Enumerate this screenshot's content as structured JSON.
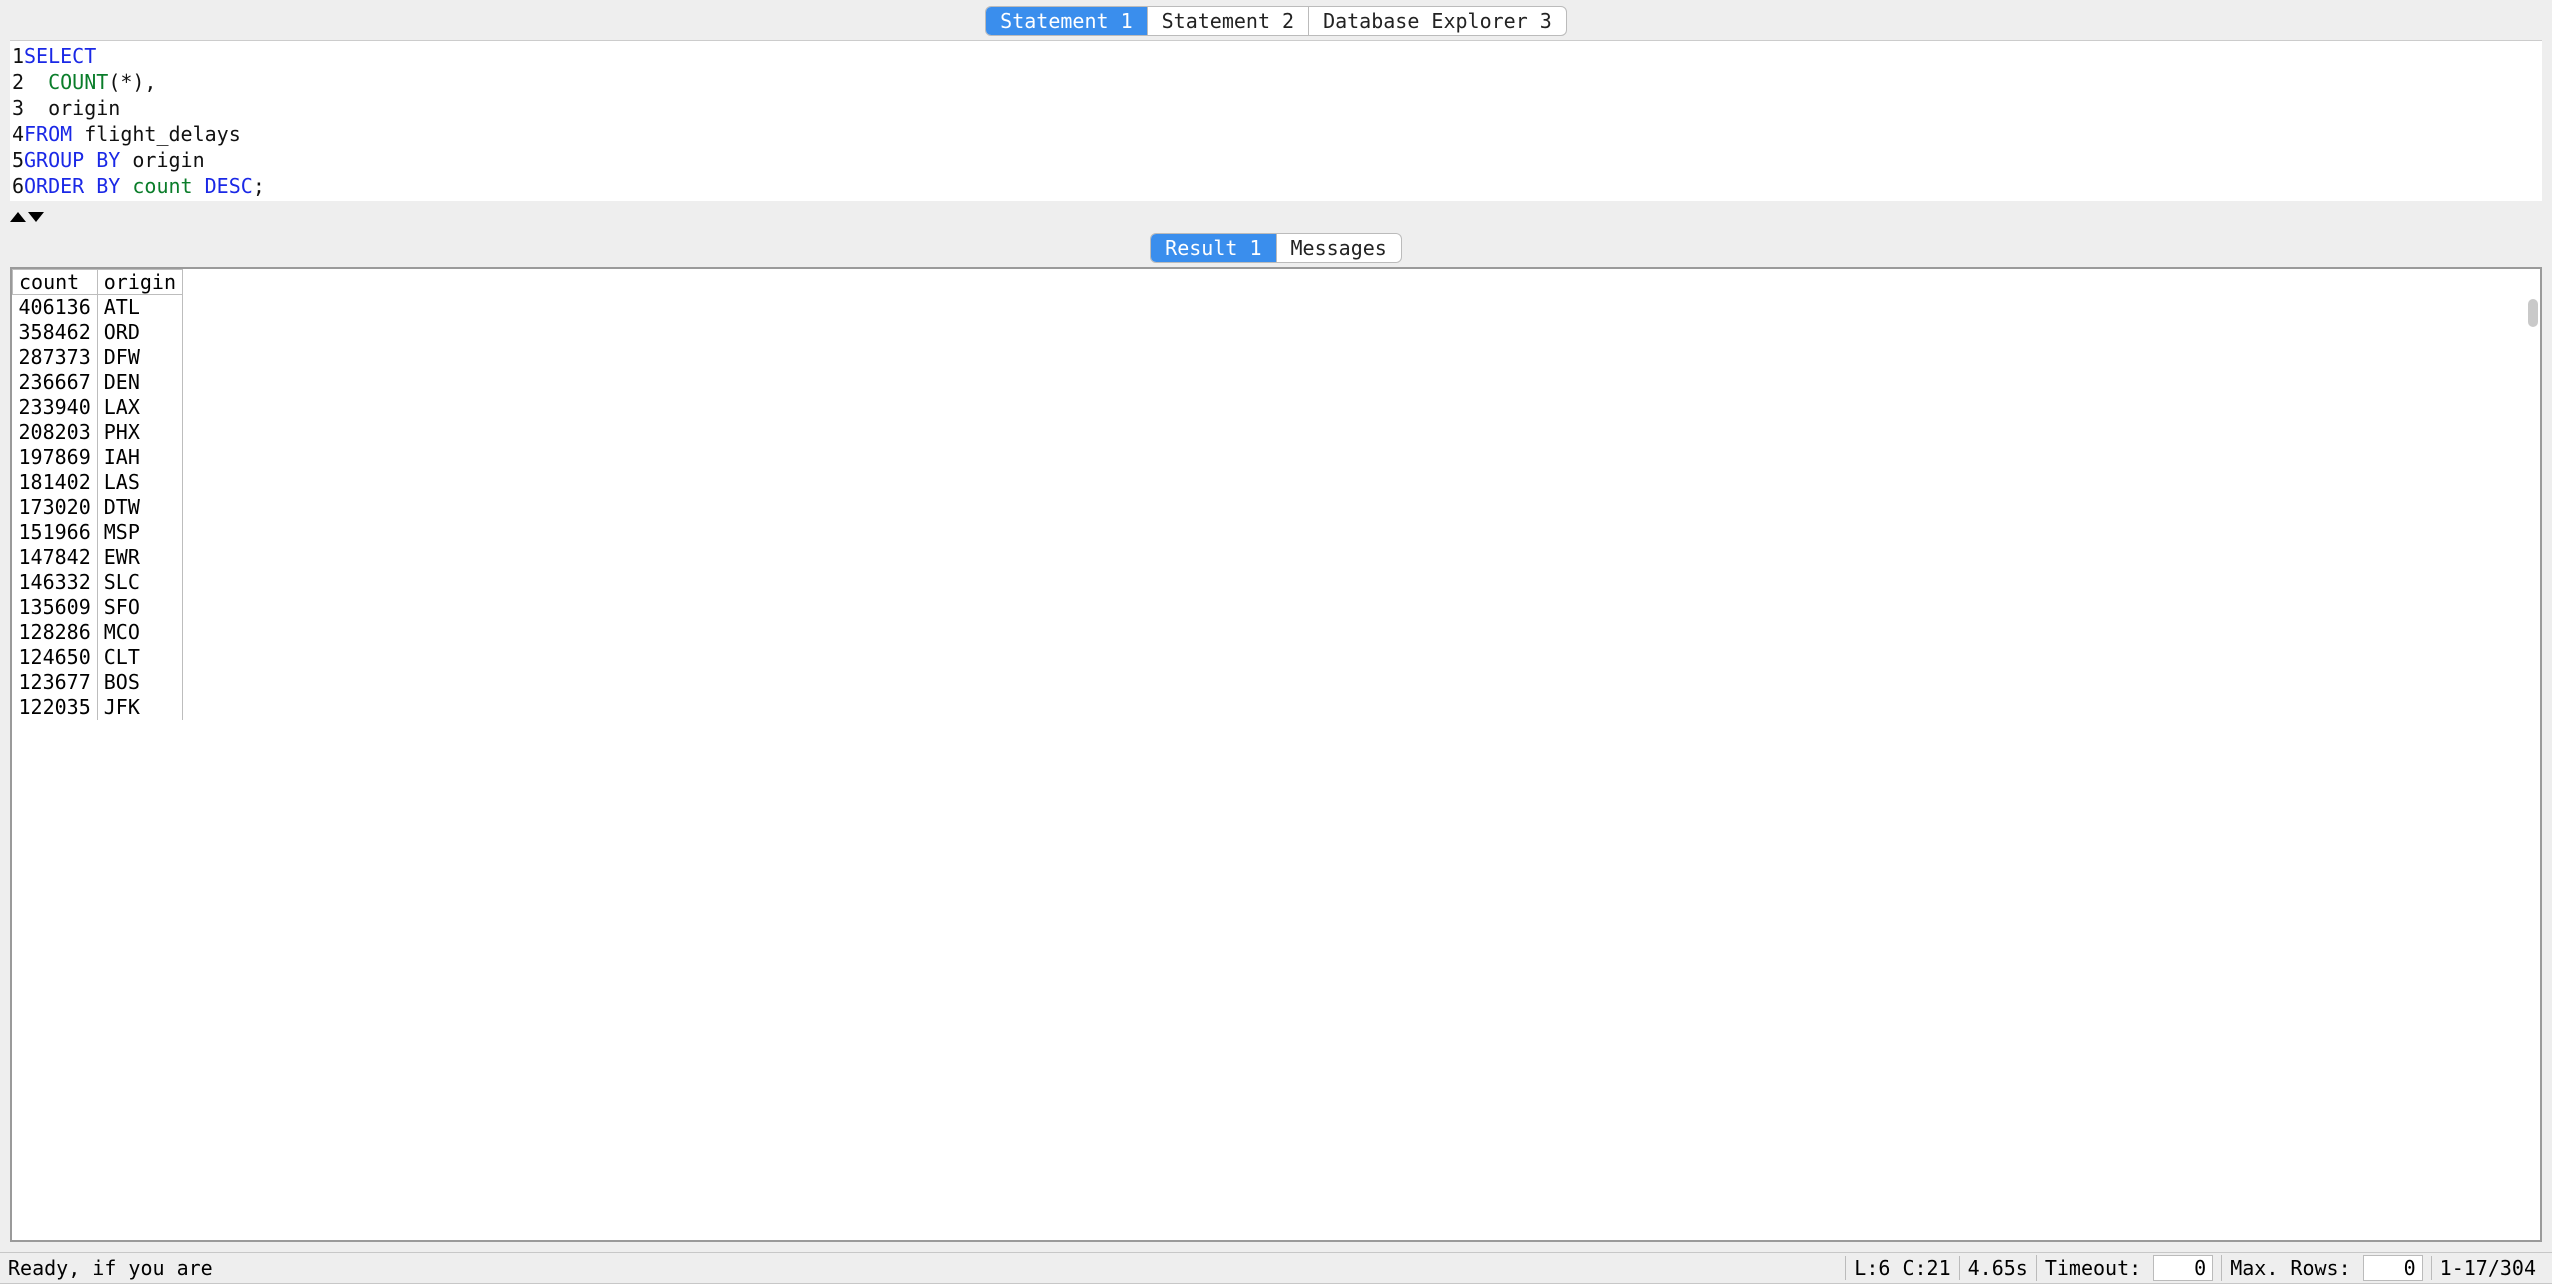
{
  "top_tabs": [
    {
      "label": "Statement 1",
      "active": true
    },
    {
      "label": "Statement 2",
      "active": false
    },
    {
      "label": "Database Explorer 3",
      "active": false
    }
  ],
  "sql": {
    "lines": [
      {
        "n": "1",
        "tokens": [
          {
            "t": "SELECT",
            "c": "kw"
          }
        ]
      },
      {
        "n": "2",
        "tokens": [
          {
            "t": "  ",
            "c": "txt"
          },
          {
            "t": "COUNT",
            "c": "fn"
          },
          {
            "t": "(*),",
            "c": "txt"
          }
        ]
      },
      {
        "n": "3",
        "tokens": [
          {
            "t": "  origin",
            "c": "txt"
          }
        ]
      },
      {
        "n": "4",
        "tokens": [
          {
            "t": "FROM",
            "c": "kw"
          },
          {
            "t": " flight_delays",
            "c": "txt"
          }
        ]
      },
      {
        "n": "5",
        "tokens": [
          {
            "t": "GROUP BY",
            "c": "kw"
          },
          {
            "t": " origin",
            "c": "txt"
          }
        ]
      },
      {
        "n": "6",
        "tokens": [
          {
            "t": "ORDER BY",
            "c": "kw"
          },
          {
            "t": " ",
            "c": "txt"
          },
          {
            "t": "count",
            "c": "id"
          },
          {
            "t": " ",
            "c": "txt"
          },
          {
            "t": "DESC",
            "c": "kw"
          },
          {
            "t": ";",
            "c": "txt"
          }
        ]
      }
    ]
  },
  "mid_tabs": [
    {
      "label": "Result 1",
      "active": true
    },
    {
      "label": "Messages",
      "active": false
    }
  ],
  "results": {
    "columns": [
      "count",
      "origin"
    ],
    "rows": [
      {
        "count": "406136",
        "origin": "ATL"
      },
      {
        "count": "358462",
        "origin": "ORD"
      },
      {
        "count": "287373",
        "origin": "DFW"
      },
      {
        "count": "236667",
        "origin": "DEN"
      },
      {
        "count": "233940",
        "origin": "LAX"
      },
      {
        "count": "208203",
        "origin": "PHX"
      },
      {
        "count": "197869",
        "origin": "IAH"
      },
      {
        "count": "181402",
        "origin": "LAS"
      },
      {
        "count": "173020",
        "origin": "DTW"
      },
      {
        "count": "151966",
        "origin": "MSP"
      },
      {
        "count": "147842",
        "origin": "EWR"
      },
      {
        "count": "146332",
        "origin": "SLC"
      },
      {
        "count": "135609",
        "origin": "SFO"
      },
      {
        "count": "128286",
        "origin": "MCO"
      },
      {
        "count": "124650",
        "origin": "CLT"
      },
      {
        "count": "123677",
        "origin": "BOS"
      },
      {
        "count": "122035",
        "origin": "JFK"
      }
    ]
  },
  "status": {
    "ready": "Ready, if you are",
    "cursor": "L:6 C:21",
    "elapsed": "4.65s",
    "timeout_label": "Timeout:",
    "timeout_value": "0",
    "maxrows_label": "Max. Rows:",
    "maxrows_value": "0",
    "range": "1-17/304"
  }
}
